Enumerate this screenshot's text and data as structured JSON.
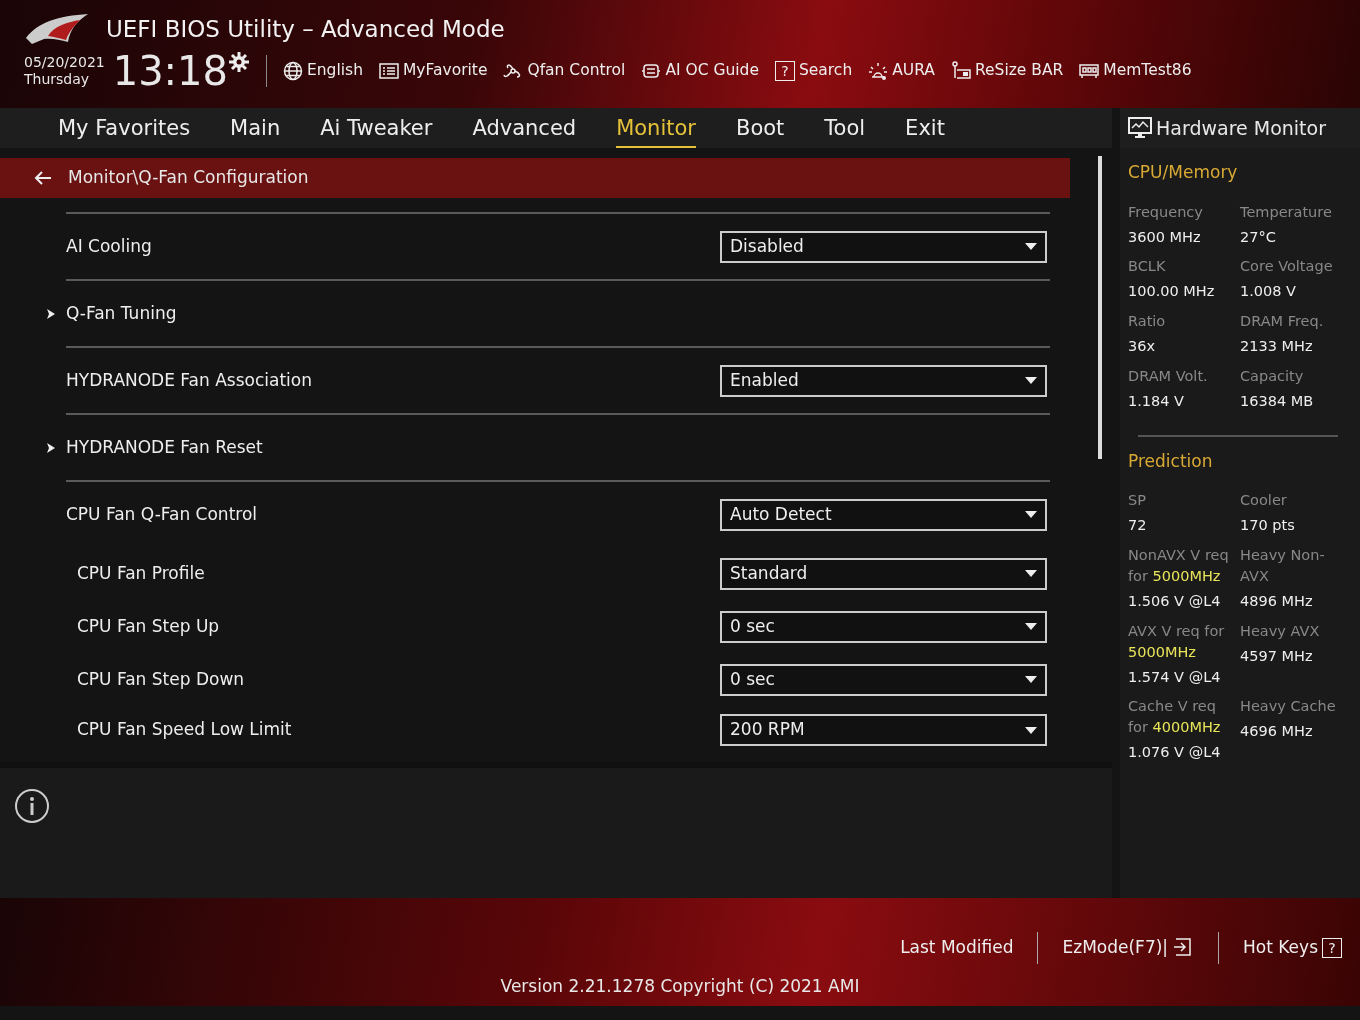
{
  "window": {
    "title": "UEFI BIOS Utility – Advanced Mode"
  },
  "clock": {
    "date": "05/20/2021",
    "weekday": "Thursday",
    "time": "13:18"
  },
  "toolbar": [
    {
      "label": "English"
    },
    {
      "label": "MyFavorite"
    },
    {
      "label": "Qfan Control"
    },
    {
      "label": "AI OC Guide"
    },
    {
      "label": "Search",
      "glyph": "?"
    },
    {
      "label": "AURA"
    },
    {
      "label": "ReSize BAR"
    },
    {
      "label": "MemTest86"
    }
  ],
  "tabs": [
    {
      "label": "My Favorites",
      "selected": false
    },
    {
      "label": "Main",
      "selected": false
    },
    {
      "label": "Ai Tweaker",
      "selected": false
    },
    {
      "label": "Advanced",
      "selected": false
    },
    {
      "label": "Monitor",
      "selected": true
    },
    {
      "label": "Boot",
      "selected": false
    },
    {
      "label": "Tool",
      "selected": false
    },
    {
      "label": "Exit",
      "selected": false
    }
  ],
  "breadcrumb": "Monitor\\Q-Fan Configuration",
  "settings": [
    {
      "kind": "dropdown",
      "label": "AI Cooling",
      "value": "Disabled"
    },
    {
      "kind": "submenu",
      "label": "Q-Fan Tuning"
    },
    {
      "kind": "dropdown",
      "label": "HYDRANODE Fan Association",
      "value": "Enabled"
    },
    {
      "kind": "submenu",
      "label": "HYDRANODE Fan Reset"
    },
    {
      "kind": "dropdown",
      "label": "CPU Fan Q-Fan Control",
      "value": "Auto Detect",
      "children": [
        {
          "kind": "dropdown",
          "label": "CPU Fan Profile",
          "value": "Standard"
        },
        {
          "kind": "dropdown",
          "label": "CPU Fan Step Up",
          "value": "0 sec"
        },
        {
          "kind": "dropdown",
          "label": "CPU Fan Step Down",
          "value": "0 sec"
        },
        {
          "kind": "dropdown",
          "label": "CPU Fan Speed Low Limit",
          "value": "200 RPM"
        }
      ]
    }
  ],
  "hardware_monitor": {
    "title": "Hardware Monitor",
    "sections": [
      {
        "title": "CPU/Memory",
        "items": [
          {
            "label": "Frequency",
            "value": "3600 MHz"
          },
          {
            "label": "Temperature",
            "value": "27°C"
          },
          {
            "label": "BCLK",
            "value": "100.00 MHz"
          },
          {
            "label": "Core Voltage",
            "value": "1.008 V"
          },
          {
            "label": "Ratio",
            "value": "36x"
          },
          {
            "label": "DRAM Freq.",
            "value": "2133 MHz"
          },
          {
            "label": "DRAM Volt.",
            "value": "1.184 V"
          },
          {
            "label": "Capacity",
            "value": "16384 MB"
          }
        ]
      },
      {
        "title": "Prediction",
        "items": [
          {
            "label": "SP",
            "value": "72"
          },
          {
            "label": "Cooler",
            "value": "170 pts"
          },
          {
            "label": "NonAVX V req for **5000MHz**",
            "value": "1.506 V @L4"
          },
          {
            "label": "Heavy Non-AVX",
            "value": "4896 MHz"
          },
          {
            "label": "AVX V req for **5000MHz**",
            "value": "1.574 V @L4"
          },
          {
            "label": "Heavy AVX",
            "value": "4597 MHz"
          },
          {
            "label": "Cache V req for **4000MHz**",
            "value": "1.076 V @L4"
          },
          {
            "label": "Heavy Cache",
            "value": "4696 MHz"
          }
        ]
      }
    ]
  },
  "footer": {
    "actions": [
      {
        "label": "Last Modified"
      },
      {
        "label": "EzMode(F7)|"
      },
      {
        "label": "Hot Keys",
        "glyph": "?"
      }
    ],
    "version": "Version 2.21.1278 Copyright (C) 2021 AMI"
  }
}
